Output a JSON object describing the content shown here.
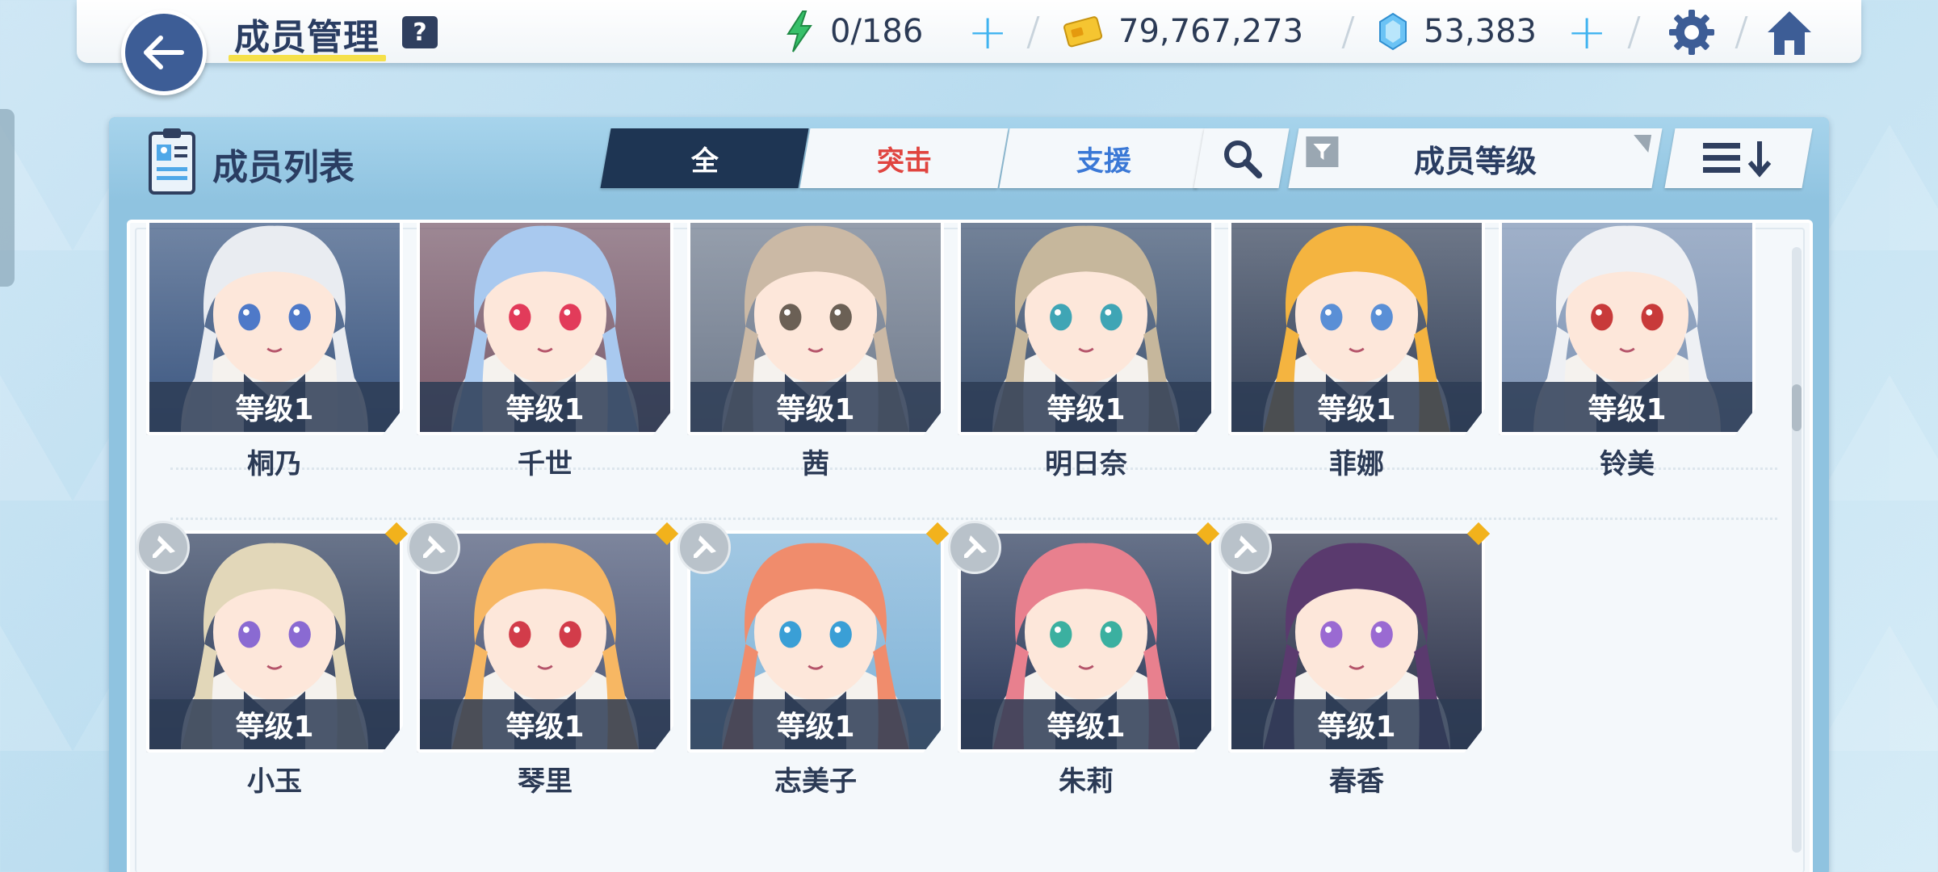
{
  "header": {
    "title": "成员管理",
    "help": "?",
    "ap": "0/186",
    "credits": "79,767,273",
    "gems": "53,383"
  },
  "panel": {
    "title": "成员列表",
    "tabs": [
      {
        "label": "全",
        "active": true
      },
      {
        "label": "突击",
        "active": false
      },
      {
        "label": "支援",
        "active": false
      }
    ],
    "sort_label": "成员等级"
  },
  "students": [
    {
      "name": "桐乃",
      "level": "等级1",
      "hair": "#e9ecf1",
      "bg": "#3b5680",
      "eyes": "#4e79c8"
    },
    {
      "name": "千世",
      "level": "等级1",
      "hair": "#a9c9ef",
      "bg": "#7a5a6a",
      "eyes": "#e23b5a"
    },
    {
      "name": "茜",
      "level": "等级1",
      "hair": "#cbb9a5",
      "bg": "#6f7a8c",
      "eyes": "#6b6055"
    },
    {
      "name": "明日奈",
      "level": "等级1",
      "hair": "#c6b79c",
      "bg": "#3e5270",
      "eyes": "#3fa5b5"
    },
    {
      "name": "菲娜",
      "level": "等级1",
      "hair": "#f4b440",
      "bg": "#37435a",
      "eyes": "#5a8fd6"
    },
    {
      "name": "铃美",
      "level": "等级1",
      "hair": "#eef0f4",
      "bg": "#7d93b4",
      "eyes": "#c83a3a"
    },
    {
      "name": "小玉",
      "level": "等级1",
      "hair": "#e2d7b9",
      "bg": "#2e3c5a",
      "eyes": "#8a6ad2"
    },
    {
      "name": "琴里",
      "level": "等级1",
      "hair": "#f7b763",
      "bg": "#4a5474",
      "eyes": "#d23c4a"
    },
    {
      "name": "志美子",
      "level": "等级1",
      "hair": "#f08c6c",
      "bg": "#7fb3d8",
      "eyes": "#3a9fd6"
    },
    {
      "name": "朱莉",
      "level": "等级1",
      "hair": "#e8808e",
      "bg": "#2a3858",
      "eyes": "#3bb0a0"
    },
    {
      "name": "春香",
      "level": "等级1",
      "hair": "#5a3a6e",
      "bg": "#2a3048",
      "eyes": "#9a6ad2"
    }
  ]
}
